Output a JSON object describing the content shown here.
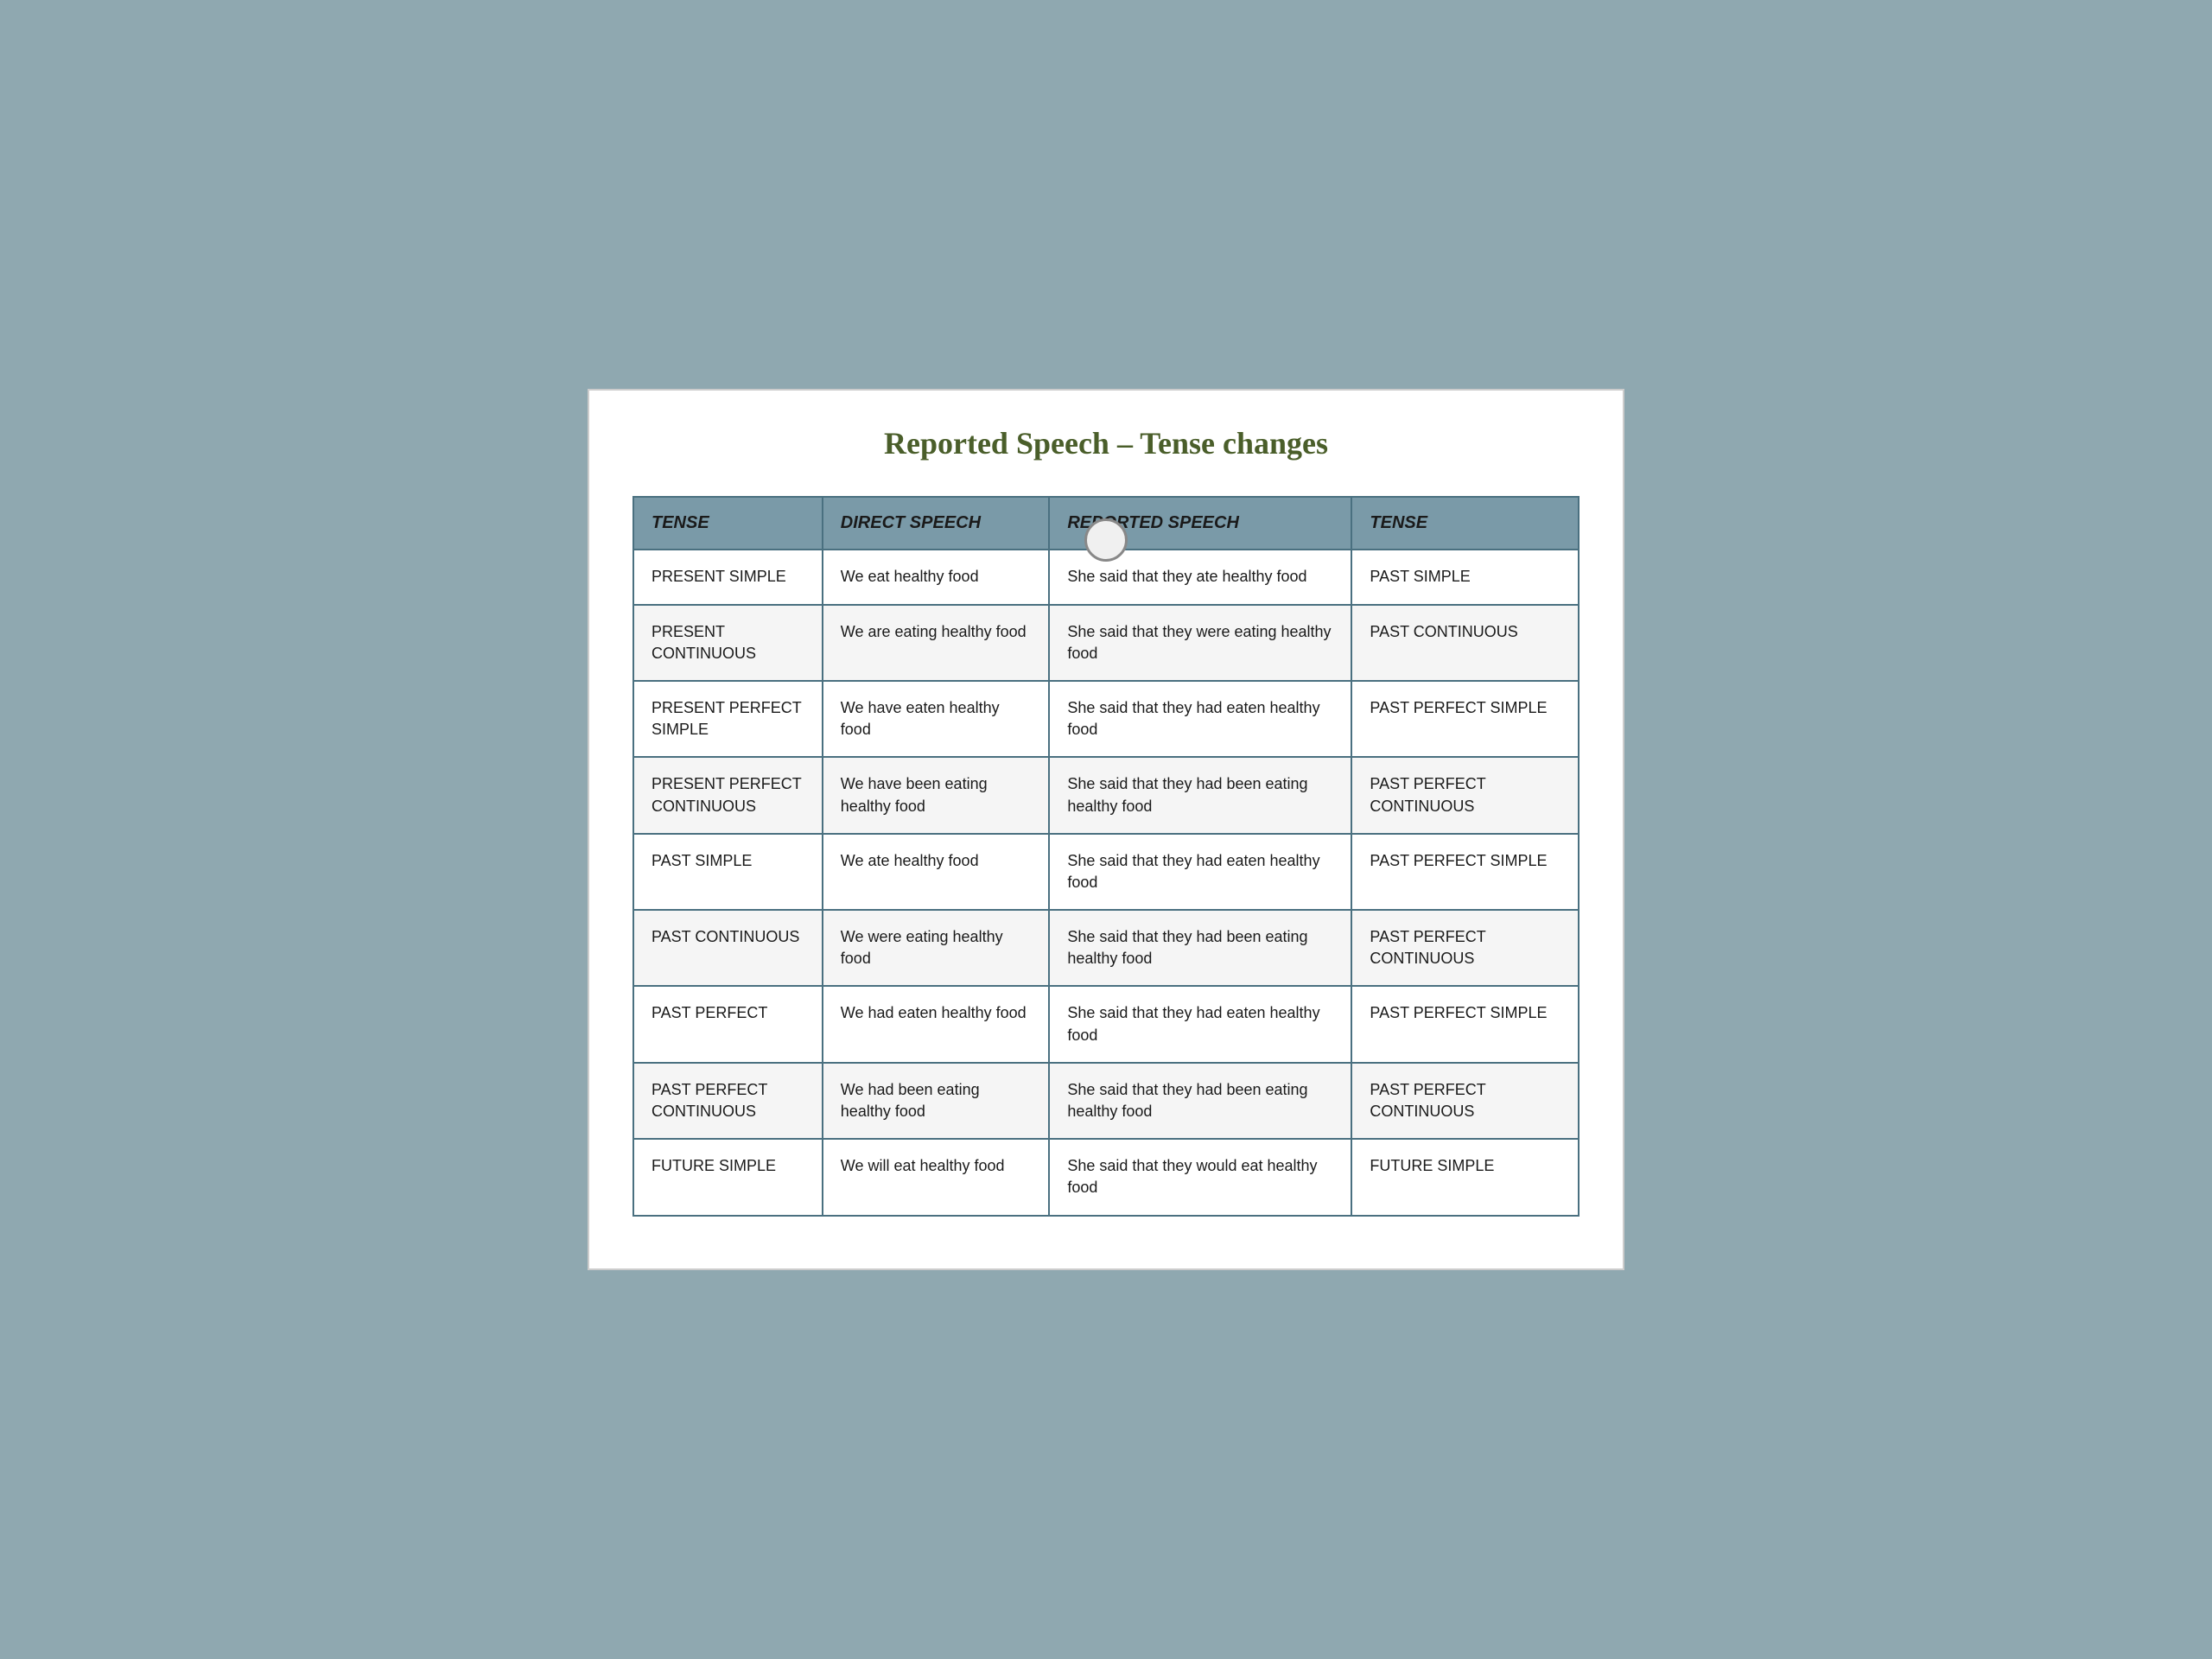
{
  "title": "Reported Speech – Tense changes",
  "circleDecoration": true,
  "table": {
    "headers": [
      {
        "id": "tense",
        "label": "TENSE"
      },
      {
        "id": "direct",
        "label": "DIRECT SPEECH"
      },
      {
        "id": "reported",
        "label": "REPORTED SPEECH"
      },
      {
        "id": "result",
        "label": "TENSE"
      }
    ],
    "rows": [
      {
        "tense": "PRESENT SIMPLE",
        "direct": "We eat healthy food",
        "reported": "She said that they ate healthy food",
        "result": "PAST SIMPLE"
      },
      {
        "tense": "PRESENT CONTINUOUS",
        "direct": "We are eating healthy food",
        "reported": "She said that they were eating healthy food",
        "result": "PAST CONTINUOUS"
      },
      {
        "tense": "PRESENT PERFECT SIMPLE",
        "direct": "We have eaten healthy food",
        "reported": "She said that they had eaten healthy food",
        "result": "PAST PERFECT SIMPLE"
      },
      {
        "tense": "PRESENT PERFECT CONTINUOUS",
        "direct": "We have been eating healthy food",
        "reported": "She said that they had been eating  healthy food",
        "result": "PAST PERFECT CONTINUOUS"
      },
      {
        "tense": "PAST SIMPLE",
        "direct": "We ate healthy food",
        "reported": "She said that they had eaten healthy food",
        "result": "PAST PERFECT SIMPLE"
      },
      {
        "tense": "PAST CONTINUOUS",
        "direct": "We were eating healthy food",
        "reported": "She said that they had been eating healthy food",
        "result": "PAST PERFECT CONTINUOUS"
      },
      {
        "tense": "PAST PERFECT",
        "direct": "We had eaten healthy food",
        "reported": "She said that they had eaten healthy food",
        "result": "PAST PERFECT SIMPLE"
      },
      {
        "tense": "PAST PERFECT CONTINUOUS",
        "direct": "We had been eating healthy food",
        "reported": "She said that they had been eating  healthy food",
        "result": "PAST PERFECT CONTINUOUS"
      },
      {
        "tense": "FUTURE SIMPLE",
        "direct": "We will eat healthy food",
        "reported": "She said that they would eat healthy food",
        "result": "FUTURE SIMPLE"
      }
    ]
  }
}
